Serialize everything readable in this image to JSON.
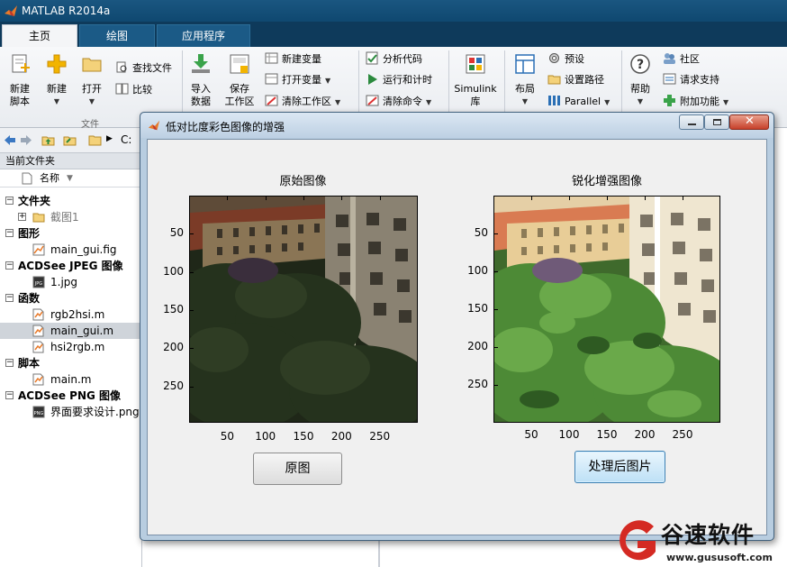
{
  "window": {
    "title": "MATLAB R2014a"
  },
  "tabs": [
    {
      "label": "主页",
      "active": true
    },
    {
      "label": "绘图",
      "active": false
    },
    {
      "label": "应用程序",
      "active": false
    }
  ],
  "ribbon": {
    "file_group": {
      "new_script": [
        "新建",
        "脚本"
      ],
      "new": "新建",
      "open": "打开",
      "find_files": "查找文件",
      "compare": "比较",
      "group_label": "文件"
    },
    "variable_group": {
      "import": [
        "导入",
        "数据"
      ],
      "save_workspace": [
        "保存",
        "工作区"
      ],
      "new_variable": "新建变量",
      "open_variable": "打开变量",
      "clear_workspace": "清除工作区"
    },
    "code_group": {
      "analyze": "分析代码",
      "run_time": "运行和计时",
      "clear_commands": "清除命令"
    },
    "simulink": [
      "Simulink",
      "库"
    ],
    "environment": {
      "layout": "布局",
      "preferences": "预设",
      "set_path": "设置路径",
      "parallel": "Parallel"
    },
    "resources": {
      "help": "帮助",
      "community": "社区",
      "request_support": "请求支持",
      "addons": "附加功能"
    }
  },
  "left_panel": {
    "path_text": "C:",
    "current_folder_title": "当前文件夹",
    "name_column": "名称",
    "groups": [
      {
        "label": "文件夹",
        "items": [
          {
            "name": "截图1",
            "type": "folder"
          }
        ]
      },
      {
        "label": "图形",
        "items": [
          {
            "name": "main_gui.fig",
            "type": "fig"
          }
        ]
      },
      {
        "label": "ACDSee JPEG 图像",
        "items": [
          {
            "name": "1.jpg",
            "type": "jpg"
          }
        ]
      },
      {
        "label": "函数",
        "items": [
          {
            "name": "rgb2hsi.m",
            "type": "m"
          },
          {
            "name": "main_gui.m",
            "type": "m",
            "selected": true
          },
          {
            "name": "hsi2rgb.m",
            "type": "m"
          }
        ]
      },
      {
        "label": "脚本",
        "items": [
          {
            "name": "main.m",
            "type": "m"
          }
        ]
      },
      {
        "label": "ACDSee PNG 图像",
        "items": [
          {
            "name": "界面要求设计.png",
            "type": "png"
          }
        ]
      }
    ]
  },
  "dialog": {
    "title": "低对比度彩色图像的增强",
    "left_axes": {
      "title": "原始图像",
      "yticks": [
        "50",
        "100",
        "150",
        "200",
        "250"
      ],
      "xticks": [
        "50",
        "100",
        "150",
        "200",
        "250"
      ]
    },
    "right_axes": {
      "title": "锐化增强图像",
      "yticks": [
        "50",
        "100",
        "150",
        "200",
        "250"
      ],
      "xticks": [
        "50",
        "100",
        "150",
        "200",
        "250"
      ]
    },
    "buttons": {
      "original": "原图",
      "processed": "处理后图片"
    }
  },
  "watermark": {
    "name": "谷速软件",
    "url": "www.gususoft.com"
  },
  "colors": {
    "titlebar": "#1a5680",
    "tab_dark": "#0e3a5b",
    "brand_red": "#d42a23"
  }
}
